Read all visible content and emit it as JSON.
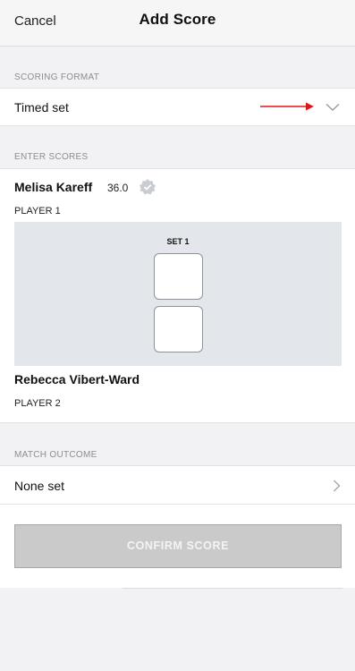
{
  "header": {
    "cancel_label": "Cancel",
    "title": "Add Score"
  },
  "scoring_format": {
    "section_label": "SCORING FORMAT",
    "value": "Timed set",
    "dropdown_icon": "chevron-down-icon",
    "annotation_arrow_color": "#e0141b"
  },
  "enter_scores": {
    "section_label": "ENTER SCORES",
    "player1": {
      "name": "Melisa Kareff",
      "rating": "36.0",
      "verified_icon": "verified-badge-icon",
      "label": "PLAYER 1"
    },
    "set_label": "SET 1",
    "player2": {
      "name": "Rebecca Vibert-Ward",
      "label": "PLAYER 2"
    }
  },
  "match_outcome": {
    "section_label": "MATCH OUTCOME",
    "value": "None set",
    "icon": "chevron-right-icon"
  },
  "confirm": {
    "label": "CONFIRM SCORE"
  },
  "colors": {
    "panel": "#e3e6eb",
    "button_disabled": "#cacaca",
    "section_label": "#8c8c92"
  }
}
